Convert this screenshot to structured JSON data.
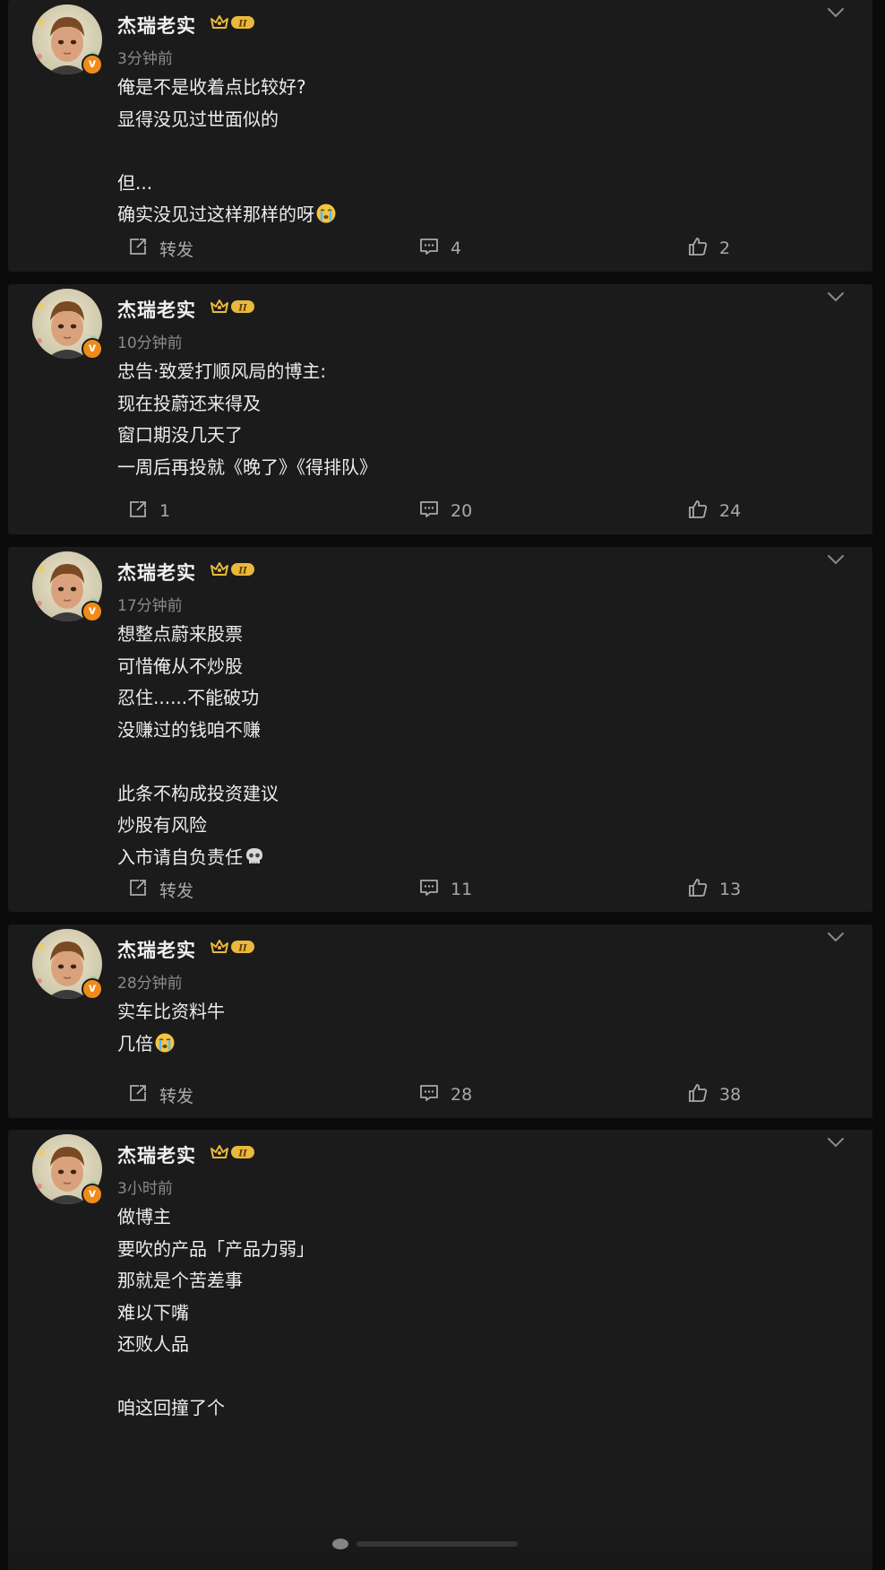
{
  "colors": {
    "background": "#0b0b0b",
    "card": "#1b1b1b",
    "text": "#ececec",
    "muted": "#8b8b8b",
    "action": "#a9a9a9",
    "verified_badge": "#f08b1a",
    "vip_gold": "#e9b93c"
  },
  "user": {
    "name": "杰瑞老实",
    "vip_level": "II",
    "verified_mark": "v"
  },
  "posts": [
    {
      "time": "3分钟前",
      "lines": [
        "俺是不是收着点比较好?",
        "显得没见过世面似的",
        "",
        "但...",
        "确实没见过这样那样的呀"
      ],
      "emoji": [
        "",
        "",
        "",
        "",
        "crying-face-icon"
      ],
      "repost": "转发",
      "comments": "4",
      "likes": "2"
    },
    {
      "time": "10分钟前",
      "lines": [
        "忠告·致爱打顺风局的博主:",
        "现在投蔚还来得及",
        "窗口期没几天了",
        "一周后再投就《晚了》《得排队》"
      ],
      "emoji": [
        "",
        "",
        "",
        ""
      ],
      "repost": "1",
      "comments": "20",
      "likes": "24"
    },
    {
      "time": "17分钟前",
      "lines": [
        "想整点蔚来股票",
        "可惜俺从不炒股",
        "忍住......不能破功",
        "没赚过的钱咱不赚",
        "",
        "此条不构成投资建议",
        "炒股有风险",
        "入市请自负责任"
      ],
      "emoji": [
        "",
        "",
        "",
        "",
        "",
        "",
        "",
        "skull-icon"
      ],
      "repost": "转发",
      "comments": "11",
      "likes": "13"
    },
    {
      "time": "28分钟前",
      "lines": [
        "实车比资料牛",
        "几倍"
      ],
      "emoji": [
        "",
        "crying-face-icon"
      ],
      "repost": "转发",
      "comments": "28",
      "likes": "38"
    },
    {
      "time": "3小时前",
      "lines": [
        "做博主",
        "要吹的产品「产品力弱」",
        "那就是个苦差事",
        "难以下嘴",
        "还败人品",
        "",
        "咱这回撞了个"
      ],
      "emoji": [
        "",
        "",
        "",
        "",
        "",
        "",
        ""
      ],
      "repost": "",
      "comments": "",
      "likes": ""
    }
  ]
}
